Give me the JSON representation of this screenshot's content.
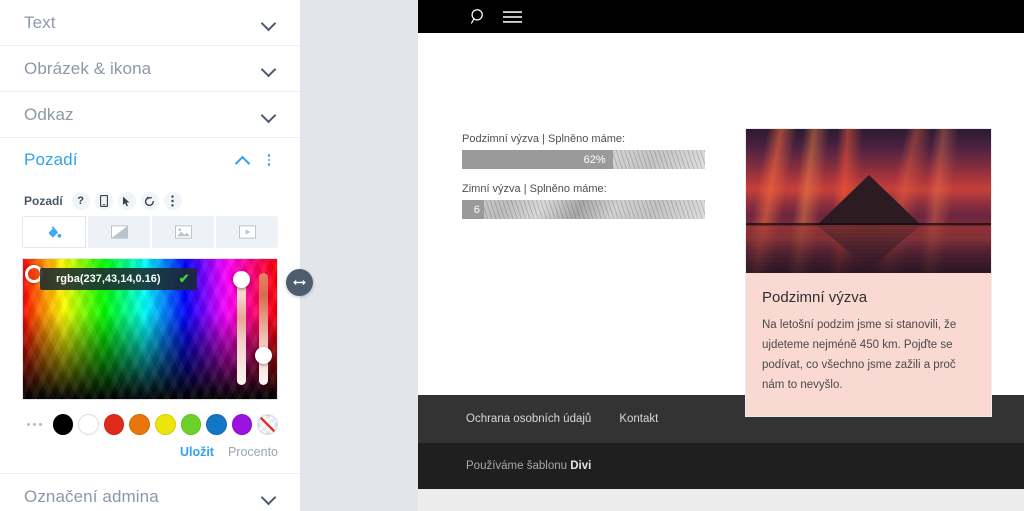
{
  "sidebar": {
    "sections": [
      {
        "label": "Text",
        "state": "collapsed"
      },
      {
        "label": "Obrázek & ikona",
        "state": "collapsed"
      },
      {
        "label": "Odkaz",
        "state": "collapsed"
      },
      {
        "label": "Pozadí",
        "state": "expanded"
      },
      {
        "label": "Označení admina",
        "state": "collapsed"
      }
    ],
    "background_panel": {
      "field_label": "Pozadí",
      "field_icons": [
        "help-icon",
        "responsive-icon",
        "hover-icon",
        "reset-icon",
        "more-options-icon"
      ],
      "type_tabs": [
        {
          "name": "color",
          "label": "Barva",
          "active": true
        },
        {
          "name": "gradient",
          "label": "Přechod",
          "active": false
        },
        {
          "name": "image",
          "label": "Obrázek",
          "active": false
        },
        {
          "name": "video",
          "label": "Video",
          "active": false
        }
      ],
      "color_value": "rgba(237,43,14,0.16)",
      "confirm_glyph": "✔",
      "swatches": [
        {
          "name": "black",
          "hex": "#000000"
        },
        {
          "name": "white",
          "hex": "#ffffff"
        },
        {
          "name": "red",
          "hex": "#e02b1a"
        },
        {
          "name": "orange",
          "hex": "#e8760d"
        },
        {
          "name": "yellow",
          "hex": "#ece40c"
        },
        {
          "name": "green",
          "hex": "#6dd12b"
        },
        {
          "name": "blue",
          "hex": "#1476c6"
        },
        {
          "name": "purple",
          "hex": "#9b13e0"
        },
        {
          "name": "none",
          "hex": "transparent"
        }
      ],
      "save_label": "Uložit",
      "unit_label": "Procento"
    }
  },
  "resizer": {
    "icon": "horizontal-resize-icon"
  },
  "preview": {
    "header": {
      "search_icon": "search-icon",
      "menu_icon": "hamburger-menu-icon"
    },
    "bars": [
      {
        "label": "Podzimní výzva | Splněno máme:",
        "percent": 62,
        "display": "62%"
      },
      {
        "label": "Zimní výzva | Splněno máme:",
        "percent": 6,
        "display": "6"
      }
    ],
    "card": {
      "image_alt": "mountain-sunset-reflection",
      "title": "Podzimní výzva",
      "text": "Na letošní podzim jsme si stanovili, že ujdeteme nejméně 450 km. Pojďte se podívat, co všechno jsme zažili a proč nám to nevyšlo.",
      "body_color": "#f9d9d2"
    },
    "footer": {
      "links": [
        "Ochrana osobních údajů",
        "Kontakt"
      ],
      "credit_prefix": "Používáme šablonu ",
      "credit_brand": "Divi"
    }
  },
  "colors": {
    "accent": "#2ea3f2",
    "sidebar_label": "#8c98a8",
    "footer_links_bg": "#333333",
    "footer_bottom_bg": "#1f1f1f",
    "bar_fill": "#9a9a9a"
  }
}
